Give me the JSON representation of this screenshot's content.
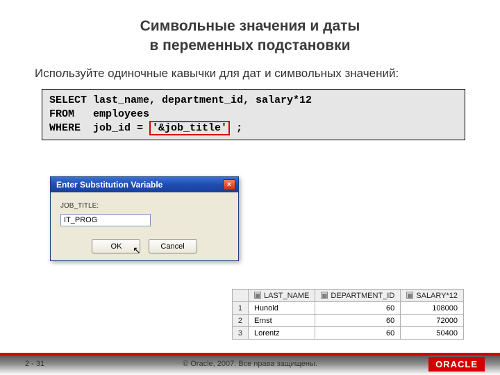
{
  "title_line1": "Символьные значения и даты",
  "title_line2": "в переменных подстановки",
  "instruction": "Используйте одиночные кавычки для дат и символьных значений:",
  "code": {
    "line1": "SELECT last_name, department_id, salary*12",
    "line2": "FROM   employees",
    "line3a": "WHERE  job_id = ",
    "highlight": "'&job_title'",
    "line3b": " ;"
  },
  "dialog": {
    "title": "Enter Substitution Variable",
    "label": "JOB_TITLE:",
    "value": "IT_PROG",
    "ok": "OK",
    "cancel": "Cancel",
    "close": "×"
  },
  "table": {
    "headers": [
      "LAST_NAME",
      "DEPARTMENT_ID",
      "SALARY*12"
    ],
    "rows": [
      {
        "n": "1",
        "last_name": "Hunold",
        "dept": "60",
        "sal": "108000"
      },
      {
        "n": "2",
        "last_name": "Ernst",
        "dept": "60",
        "sal": "72000"
      },
      {
        "n": "3",
        "last_name": "Lorentz",
        "dept": "60",
        "sal": "50400"
      }
    ]
  },
  "footer": {
    "page": "2 - 31",
    "copyright": "© Oracle, 2007. Все права защищены.",
    "logo": "ORACLE"
  }
}
